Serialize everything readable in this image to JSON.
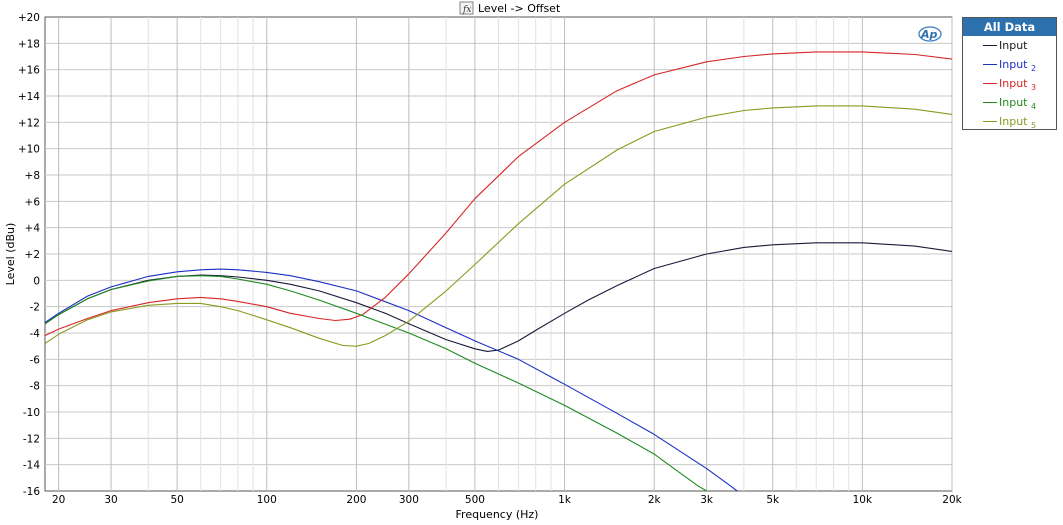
{
  "window": {
    "title": "Level -> Offset",
    "fx_icon": "fx-icon",
    "logo_text": "Ap"
  },
  "legend": {
    "header": "All Data",
    "items": [
      {
        "label": "Input",
        "sub": "",
        "color": "#1a1a3a"
      },
      {
        "label": "Input",
        "sub": "2",
        "color": "#1c2fc4"
      },
      {
        "label": "Input",
        "sub": "3",
        "color": "#d62626"
      },
      {
        "label": "Input",
        "sub": "4",
        "color": "#1f8a1f"
      },
      {
        "label": "Input",
        "sub": "5",
        "color": "#8a9a1f"
      }
    ]
  },
  "chart_data": {
    "type": "line",
    "xlabel": "Frequency (Hz)",
    "ylabel": "Level (dBu)",
    "xscale": "log",
    "xlim": [
      18,
      20000
    ],
    "ylim": [
      -16,
      20
    ],
    "grid": true,
    "xticks": [
      {
        "v": 20,
        "label": "20"
      },
      {
        "v": 30,
        "label": "30"
      },
      {
        "v": 50,
        "label": "50"
      },
      {
        "v": 100,
        "label": "100"
      },
      {
        "v": 200,
        "label": "200"
      },
      {
        "v": 300,
        "label": "300"
      },
      {
        "v": 500,
        "label": "500"
      },
      {
        "v": 1000,
        "label": "1k"
      },
      {
        "v": 2000,
        "label": "2k"
      },
      {
        "v": 3000,
        "label": "3k"
      },
      {
        "v": 5000,
        "label": "5k"
      },
      {
        "v": 10000,
        "label": "10k"
      },
      {
        "v": 20000,
        "label": "20k"
      }
    ],
    "yticks": [
      {
        "v": 20,
        "label": "+20"
      },
      {
        "v": 18,
        "label": "+18"
      },
      {
        "v": 16,
        "label": "+16"
      },
      {
        "v": 14,
        "label": "+14"
      },
      {
        "v": 12,
        "label": "+12"
      },
      {
        "v": 10,
        "label": "+10"
      },
      {
        "v": 8,
        "label": "+8"
      },
      {
        "v": 6,
        "label": "+6"
      },
      {
        "v": 4,
        "label": "+4"
      },
      {
        "v": 2,
        "label": "+2"
      },
      {
        "v": 0,
        "label": "0"
      },
      {
        "v": -2,
        "label": "-2"
      },
      {
        "v": -4,
        "label": "-4"
      },
      {
        "v": -6,
        "label": "-6"
      },
      {
        "v": -8,
        "label": "-8"
      },
      {
        "v": -10,
        "label": "-10"
      },
      {
        "v": -12,
        "label": "-12"
      },
      {
        "v": -14,
        "label": "-14"
      },
      {
        "v": -16,
        "label": "-16"
      }
    ],
    "series": [
      {
        "name": "Input",
        "color": "#1a1a3a",
        "points": [
          [
            18,
            -3.3
          ],
          [
            20,
            -2.6
          ],
          [
            25,
            -1.4
          ],
          [
            30,
            -0.7
          ],
          [
            40,
            0.0
          ],
          [
            50,
            0.3
          ],
          [
            60,
            0.4
          ],
          [
            70,
            0.35
          ],
          [
            80,
            0.25
          ],
          [
            100,
            0.0
          ],
          [
            120,
            -0.3
          ],
          [
            150,
            -0.8
          ],
          [
            200,
            -1.7
          ],
          [
            250,
            -2.5
          ],
          [
            300,
            -3.3
          ],
          [
            400,
            -4.5
          ],
          [
            500,
            -5.2
          ],
          [
            550,
            -5.4
          ],
          [
            600,
            -5.3
          ],
          [
            700,
            -4.6
          ],
          [
            800,
            -3.8
          ],
          [
            1000,
            -2.5
          ],
          [
            1200,
            -1.5
          ],
          [
            1500,
            -0.4
          ],
          [
            2000,
            0.9
          ],
          [
            3000,
            2.0
          ],
          [
            4000,
            2.5
          ],
          [
            5000,
            2.7
          ],
          [
            7000,
            2.85
          ],
          [
            10000,
            2.85
          ],
          [
            15000,
            2.6
          ],
          [
            20000,
            2.2
          ]
        ]
      },
      {
        "name": "Input 2",
        "color": "#1c2fc4",
        "points": [
          [
            18,
            -3.2
          ],
          [
            20,
            -2.5
          ],
          [
            25,
            -1.2
          ],
          [
            30,
            -0.5
          ],
          [
            40,
            0.3
          ],
          [
            50,
            0.65
          ],
          [
            60,
            0.8
          ],
          [
            70,
            0.85
          ],
          [
            80,
            0.8
          ],
          [
            100,
            0.6
          ],
          [
            120,
            0.35
          ],
          [
            150,
            -0.1
          ],
          [
            200,
            -0.8
          ],
          [
            300,
            -2.3
          ],
          [
            400,
            -3.6
          ],
          [
            500,
            -4.6
          ],
          [
            700,
            -6.0
          ],
          [
            1000,
            -7.9
          ],
          [
            1500,
            -10.1
          ],
          [
            2000,
            -11.7
          ],
          [
            3000,
            -14.3
          ],
          [
            3600,
            -15.6
          ],
          [
            3800,
            -16.0
          ]
        ]
      },
      {
        "name": "Input 3",
        "color": "#d62626",
        "points": [
          [
            18,
            -4.2
          ],
          [
            20,
            -3.7
          ],
          [
            25,
            -2.9
          ],
          [
            30,
            -2.3
          ],
          [
            40,
            -1.7
          ],
          [
            50,
            -1.4
          ],
          [
            60,
            -1.3
          ],
          [
            70,
            -1.4
          ],
          [
            80,
            -1.6
          ],
          [
            100,
            -2.0
          ],
          [
            120,
            -2.5
          ],
          [
            150,
            -2.9
          ],
          [
            170,
            -3.05
          ],
          [
            190,
            -2.95
          ],
          [
            210,
            -2.6
          ],
          [
            250,
            -1.3
          ],
          [
            300,
            0.5
          ],
          [
            400,
            3.6
          ],
          [
            500,
            6.2
          ],
          [
            700,
            9.4
          ],
          [
            1000,
            12.0
          ],
          [
            1500,
            14.4
          ],
          [
            2000,
            15.6
          ],
          [
            3000,
            16.6
          ],
          [
            4000,
            17.0
          ],
          [
            5000,
            17.2
          ],
          [
            7000,
            17.35
          ],
          [
            10000,
            17.35
          ],
          [
            15000,
            17.15
          ],
          [
            20000,
            16.8
          ]
        ]
      },
      {
        "name": "Input 4",
        "color": "#1f8a1f",
        "points": [
          [
            18,
            -3.3
          ],
          [
            20,
            -2.6
          ],
          [
            25,
            -1.4
          ],
          [
            30,
            -0.7
          ],
          [
            40,
            -0.05
          ],
          [
            50,
            0.3
          ],
          [
            60,
            0.35
          ],
          [
            70,
            0.3
          ],
          [
            80,
            0.1
          ],
          [
            100,
            -0.3
          ],
          [
            120,
            -0.8
          ],
          [
            150,
            -1.5
          ],
          [
            200,
            -2.5
          ],
          [
            300,
            -4.0
          ],
          [
            400,
            -5.2
          ],
          [
            500,
            -6.3
          ],
          [
            700,
            -7.8
          ],
          [
            1000,
            -9.5
          ],
          [
            1500,
            -11.6
          ],
          [
            2000,
            -13.2
          ],
          [
            2400,
            -14.5
          ],
          [
            2800,
            -15.6
          ],
          [
            3000,
            -16.0
          ]
        ]
      },
      {
        "name": "Input 5",
        "color": "#8a9a1f",
        "points": [
          [
            18,
            -4.8
          ],
          [
            20,
            -4.1
          ],
          [
            25,
            -3.0
          ],
          [
            30,
            -2.4
          ],
          [
            40,
            -1.9
          ],
          [
            50,
            -1.75
          ],
          [
            60,
            -1.75
          ],
          [
            70,
            -2.0
          ],
          [
            80,
            -2.3
          ],
          [
            100,
            -3.0
          ],
          [
            120,
            -3.6
          ],
          [
            150,
            -4.4
          ],
          [
            180,
            -4.95
          ],
          [
            200,
            -5.0
          ],
          [
            220,
            -4.8
          ],
          [
            250,
            -4.2
          ],
          [
            300,
            -3.1
          ],
          [
            400,
            -0.8
          ],
          [
            500,
            1.2
          ],
          [
            700,
            4.3
          ],
          [
            1000,
            7.3
          ],
          [
            1500,
            9.9
          ],
          [
            2000,
            11.3
          ],
          [
            3000,
            12.4
          ],
          [
            4000,
            12.9
          ],
          [
            5000,
            13.1
          ],
          [
            7000,
            13.25
          ],
          [
            10000,
            13.25
          ],
          [
            15000,
            13.0
          ],
          [
            20000,
            12.6
          ]
        ]
      }
    ]
  }
}
